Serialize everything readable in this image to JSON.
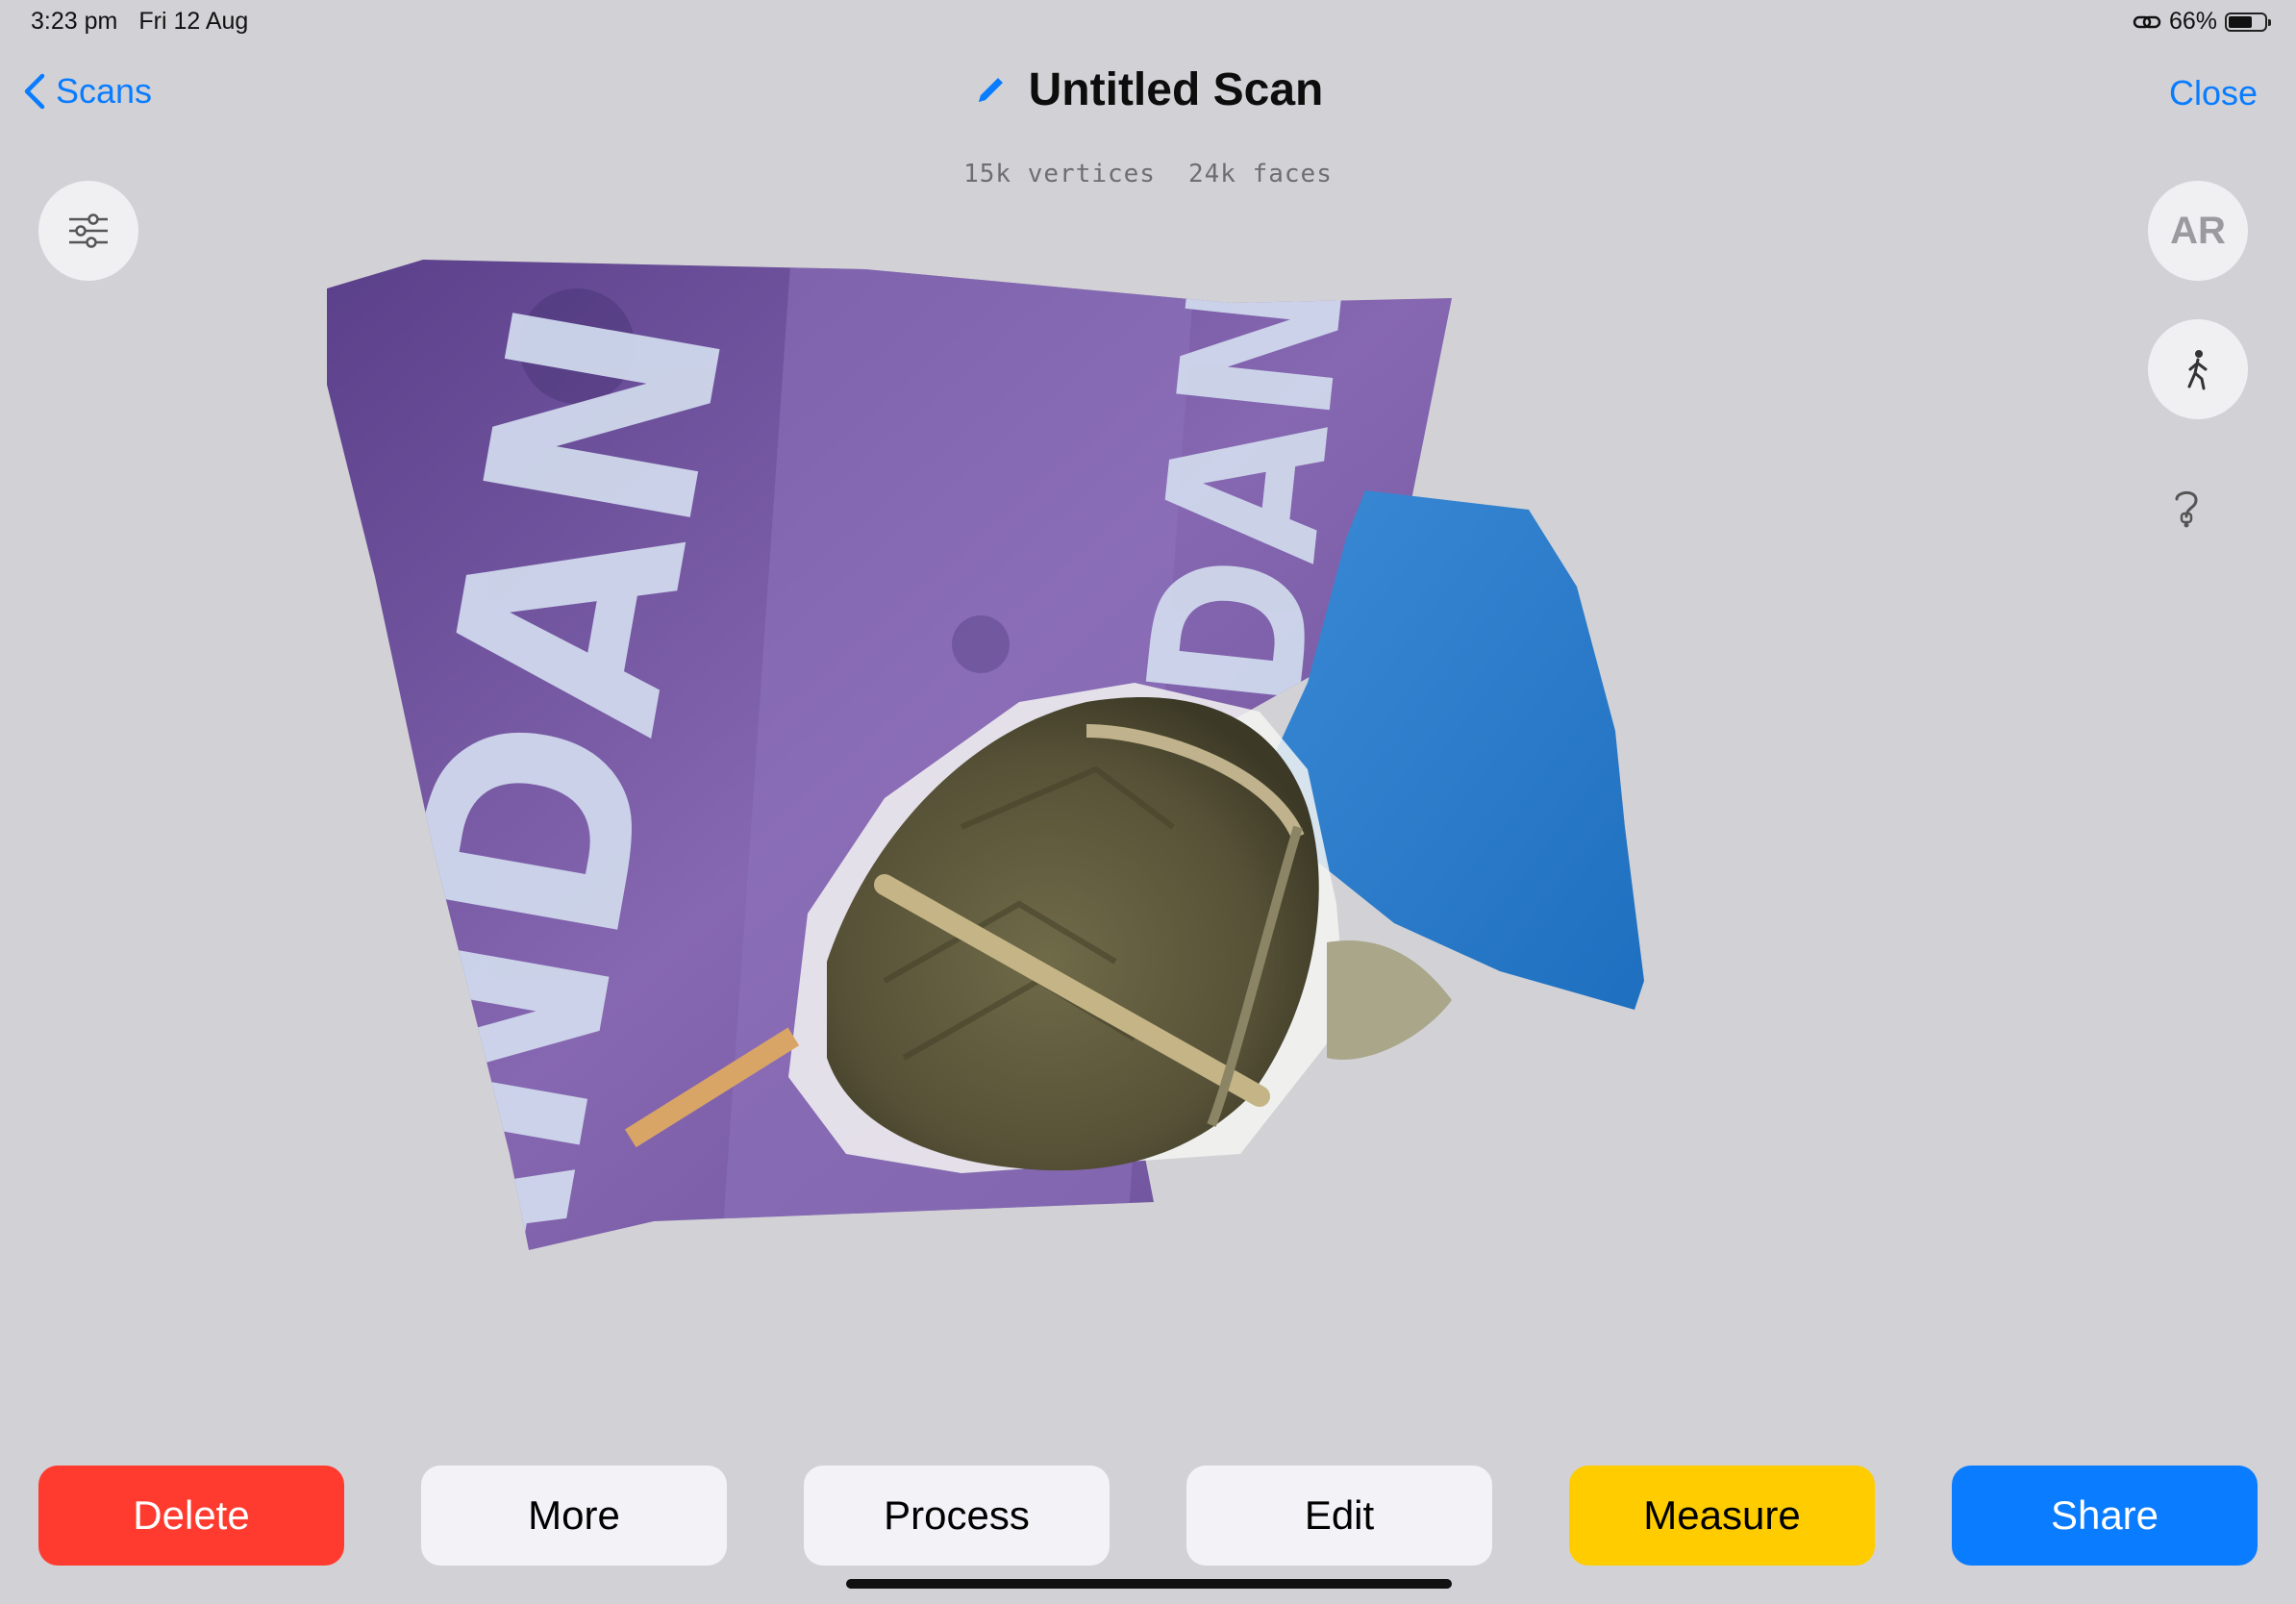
{
  "status_bar": {
    "time": "3:23 pm",
    "date": "Fri 12 Aug",
    "battery": "66%",
    "battery_level": 0.66
  },
  "nav": {
    "back_label": "Scans",
    "title": "Untitled Scan",
    "close_label": "Close"
  },
  "stats": {
    "vertices": "15k vertices",
    "faces": "24k faces"
  },
  "side_controls": {
    "ar_label": "AR",
    "icons": [
      "sliders-icon",
      "walk-icon",
      "help-icon"
    ]
  },
  "scan_text": "ANDAN",
  "toolbar": {
    "buttons": [
      {
        "label": "Delete",
        "color": "#ff3b30",
        "text_color": "#ffffff"
      },
      {
        "label": "More",
        "color": "#f2f2f7",
        "text_color": "#000000"
      },
      {
        "label": "Process",
        "color": "#f2f2f7",
        "text_color": "#000000"
      },
      {
        "label": "Edit",
        "color": "#f2f2f7",
        "text_color": "#000000"
      },
      {
        "label": "Measure",
        "color": "#ffcc00",
        "text_color": "#000000"
      },
      {
        "label": "Share",
        "color": "#0a7cff",
        "text_color": "#ffffff"
      }
    ]
  },
  "colors": {
    "accent": "#0a7cff",
    "background": "#d2d2d6"
  }
}
